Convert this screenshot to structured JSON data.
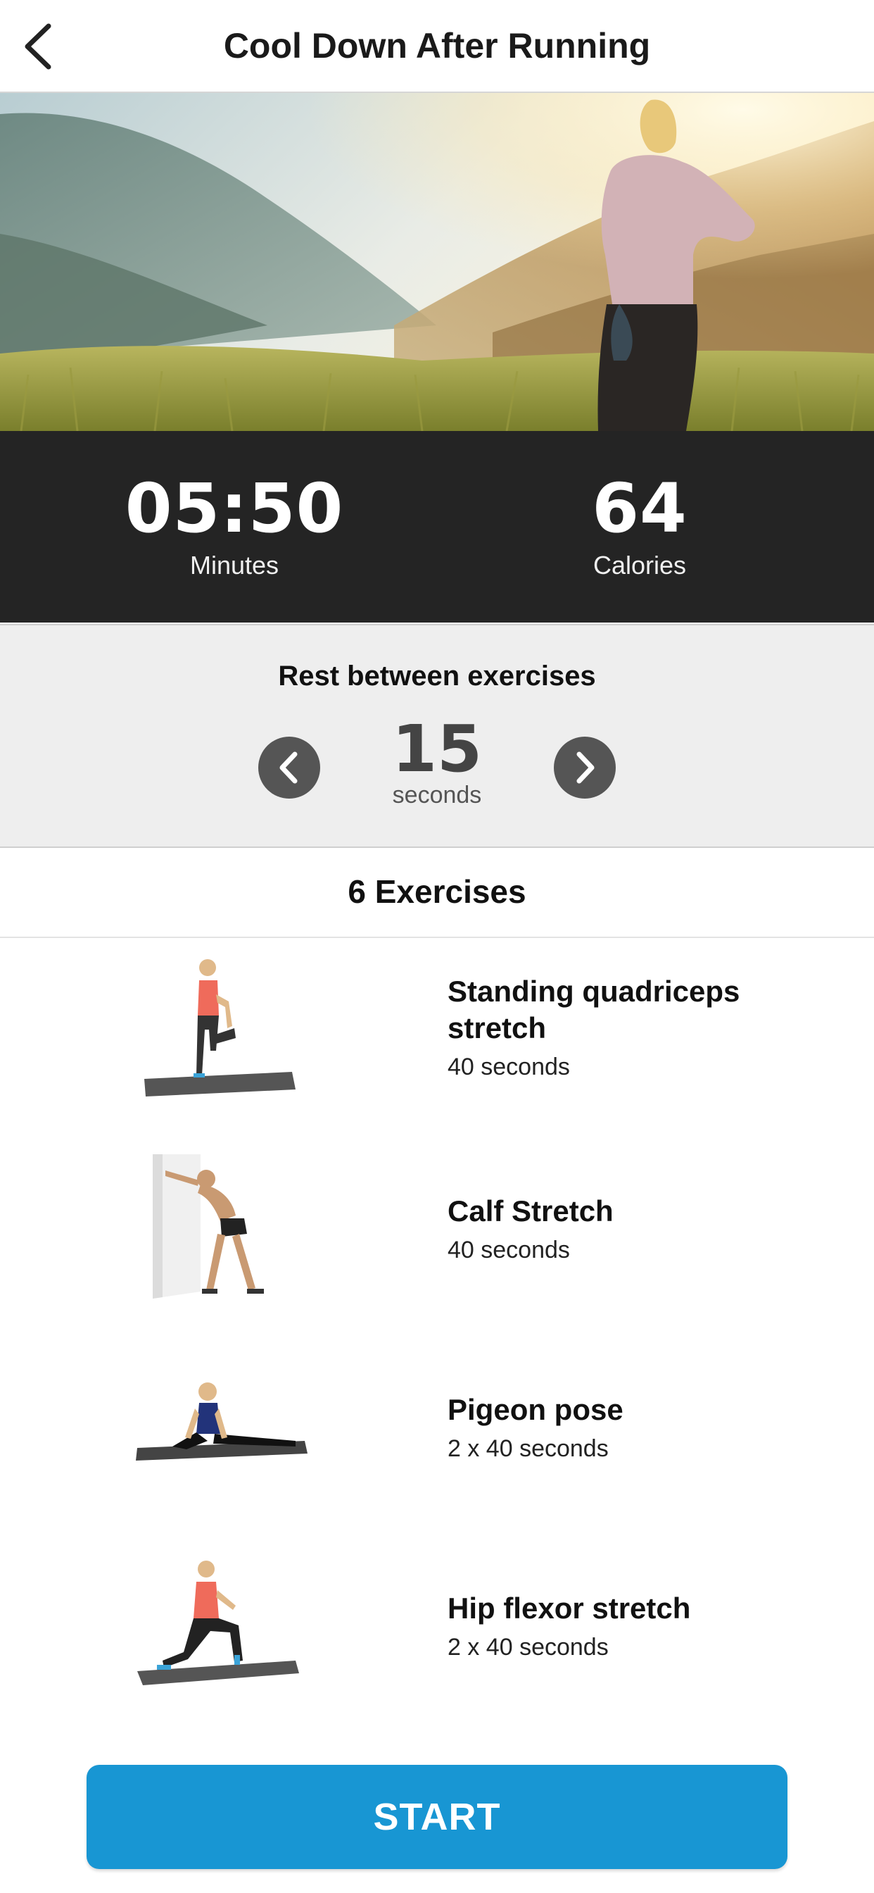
{
  "header": {
    "title": "Cool Down After Running",
    "back_icon": "chevron-left-icon"
  },
  "hero": {
    "image": "woman-stretching-mountains-photo"
  },
  "stats": {
    "duration_value": "05:50",
    "duration_label": "Minutes",
    "calories_value": "64",
    "calories_label": "Calories"
  },
  "rest": {
    "title": "Rest between exercises",
    "value": "15",
    "unit": "seconds",
    "prev_icon": "chevron-left-icon",
    "next_icon": "chevron-right-icon"
  },
  "exercises": {
    "count_label": "6 Exercises",
    "items": [
      {
        "name": "Standing quadriceps stretch",
        "duration": "40 seconds",
        "thumb": "standing-quad-stretch-image"
      },
      {
        "name": "Calf Stretch",
        "duration": "40 seconds",
        "thumb": "calf-stretch-image"
      },
      {
        "name": "Pigeon pose",
        "duration": "2 x 40 seconds",
        "thumb": "pigeon-pose-image"
      },
      {
        "name": "Hip flexor stretch",
        "duration": "2 x 40 seconds",
        "thumb": "hip-flexor-stretch-image"
      }
    ]
  },
  "start_button": {
    "label": "START"
  },
  "colors": {
    "accent": "#1896d3",
    "stats_bg": "#242424",
    "rest_bg": "#eeeeee",
    "arrow_btn": "#555555"
  }
}
